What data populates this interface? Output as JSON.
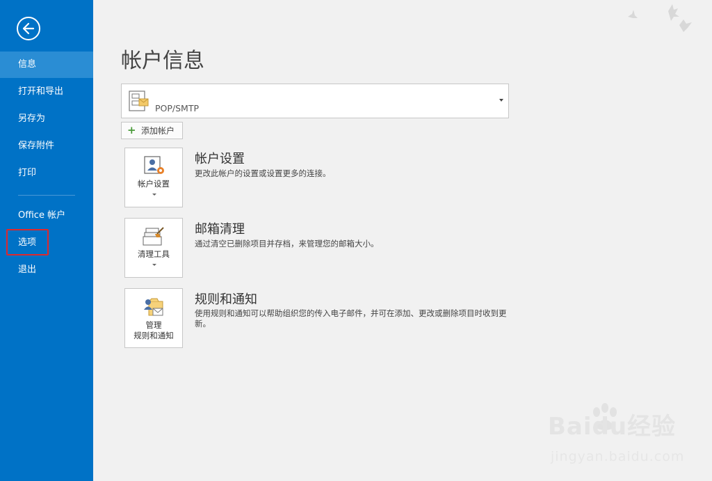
{
  "sidebar": {
    "back": "back-arrow",
    "items": [
      {
        "label": "信息",
        "active": true
      },
      {
        "label": "打开和导出"
      },
      {
        "label": "另存为"
      },
      {
        "label": "保存附件"
      },
      {
        "label": "打印"
      },
      {
        "label": "Office 帐户"
      },
      {
        "label": "选项",
        "highlighted": true
      },
      {
        "label": "退出"
      }
    ]
  },
  "main": {
    "title": "帐户信息",
    "account": {
      "type": "POP/SMTP"
    },
    "add_account": "添加帐户",
    "sections": [
      {
        "tile_label": "帐户设置",
        "title": "帐户设置",
        "desc": "更改此帐户的设置或设置更多的连接。"
      },
      {
        "tile_label": "清理工具",
        "title": "邮箱清理",
        "desc": "通过清空已删除项目并存档，来管理您的邮箱大小。"
      },
      {
        "tile_label_line1": "管理",
        "tile_label_line2": "规则和通知",
        "title": "规则和通知",
        "desc": "使用规则和通知可以帮助组织您的传入电子邮件，并可在添加、更改或删除项目时收到更新。"
      }
    ]
  },
  "watermark": {
    "brand": "Baidu经验",
    "url": "jingyan.baidu.com"
  },
  "colors": {
    "sidebar": "#0072c6",
    "active": "#2a8dd4",
    "highlight": "#e0282c"
  }
}
